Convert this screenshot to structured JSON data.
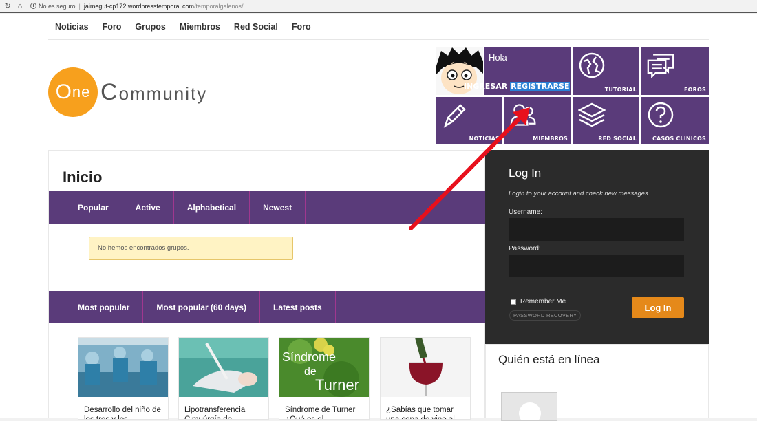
{
  "browser": {
    "security": "No es seguro",
    "url_host": "jaimegut-cp172.wordpresstemporal.com",
    "url_path": "/temporalgalenos/"
  },
  "topnav": [
    "Noticias",
    "Foro",
    "Grupos",
    "Miembros",
    "Red Social",
    "Foro"
  ],
  "logo": {
    "first": "ne",
    "first_cap": "O",
    "second": "ommunity",
    "second_cap": "C"
  },
  "tiles": {
    "hola": "Hola",
    "ingresar": "INGRESAR",
    "registrarse": "REGISTRARSE",
    "tutorial": "TUTORIAL",
    "foros": "FOROS",
    "noticias": "NOTICIAS",
    "miembros": "MIEMBROS",
    "red_social": "RED SOCIAL",
    "casos": "CASOS CLINICOS"
  },
  "main": {
    "title": "Inicio",
    "group_tabs": [
      "Popular",
      "Active",
      "Alphabetical",
      "Newest"
    ],
    "notice": "No hemos encontrados grupos.",
    "post_tabs": [
      "Most popular",
      "Most popular (60 days)",
      "Latest posts"
    ],
    "posts": [
      {
        "title": "Desarrollo del niño de los tres y los"
      },
      {
        "title": "Lipotransferencia Cimuúrgía de"
      },
      {
        "title": "Síndrome de Turner ¿Qué es el"
      },
      {
        "title": "¿Sabías que tomar una copa de vino al"
      }
    ],
    "turner_word1": "Síndrome",
    "turner_word2": "de",
    "turner_word3": "Turner"
  },
  "login": {
    "title": "Log In",
    "subtitle": "Login to your account and check new messages.",
    "username_label": "Username:",
    "password_label": "Password:",
    "remember": "Remember Me",
    "recovery": "PASSWORD RECOVERY",
    "button": "Log In"
  },
  "online": {
    "title": "Quién está en línea"
  },
  "colors": {
    "purple": "#5a3b7a",
    "orange": "#f7a01d",
    "dark": "#2b2b2b",
    "arrow": "#e8101c"
  }
}
